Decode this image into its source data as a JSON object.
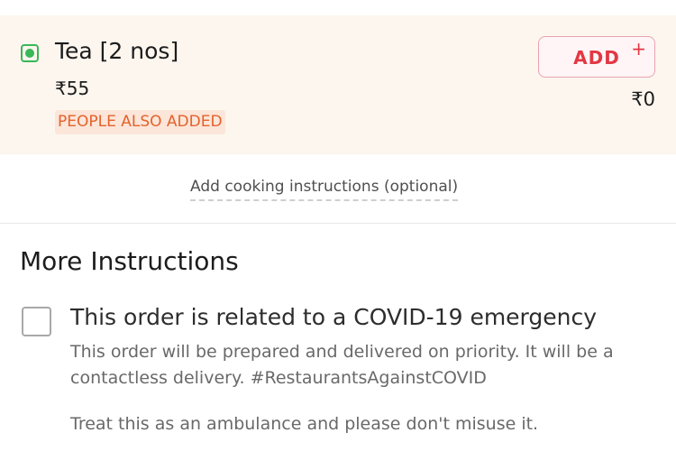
{
  "item": {
    "name": "Tea [2 nos]",
    "price": "₹55",
    "tag": "PEOPLE ALSO ADDED",
    "add_label": "ADD",
    "add_plus": "+",
    "total": "₹0",
    "veg": true
  },
  "cooking_instructions_link": "Add cooking instructions (optional)",
  "more_instructions": {
    "title": "More Instructions",
    "covid": {
      "checked": false,
      "label": "This order is related to a COVID-19 emergency",
      "description": "This order will be prepared and delivered on priority. It will be a contactless delivery. #RestaurantsAgainstCOVID",
      "note": "Treat this as an ambulance and please don't misuse it."
    }
  },
  "colors": {
    "veg_green": "#3ab757",
    "accent_red": "#e23744",
    "tag_orange": "#e5622c",
    "card_bg": "#fcf6ef"
  }
}
